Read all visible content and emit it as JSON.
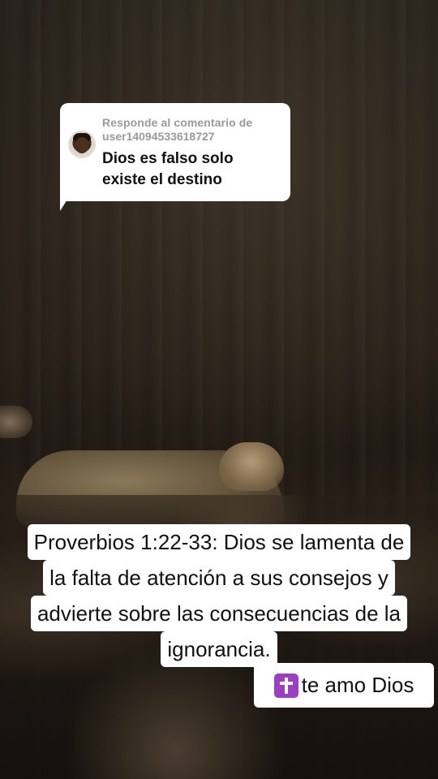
{
  "reply": {
    "header": "Responde al comentario de",
    "username": "user14094533618727",
    "comment_line1": "Dios es falso solo",
    "comment_line2": "existe el destino"
  },
  "caption": {
    "lines": [
      "Proverbios 1:22-33: Dios se lamenta de",
      "la falta de atención a sus consejos y",
      "advierte sobre las consecuencias de la",
      "ignorancia."
    ]
  },
  "tag": {
    "icon": "latin-cross-icon",
    "text": "te amo Dios"
  },
  "colors": {
    "bubble_bg": "#ffffff",
    "muted_text": "#9a9a9a",
    "cross_badge": "#9b3fc0"
  }
}
